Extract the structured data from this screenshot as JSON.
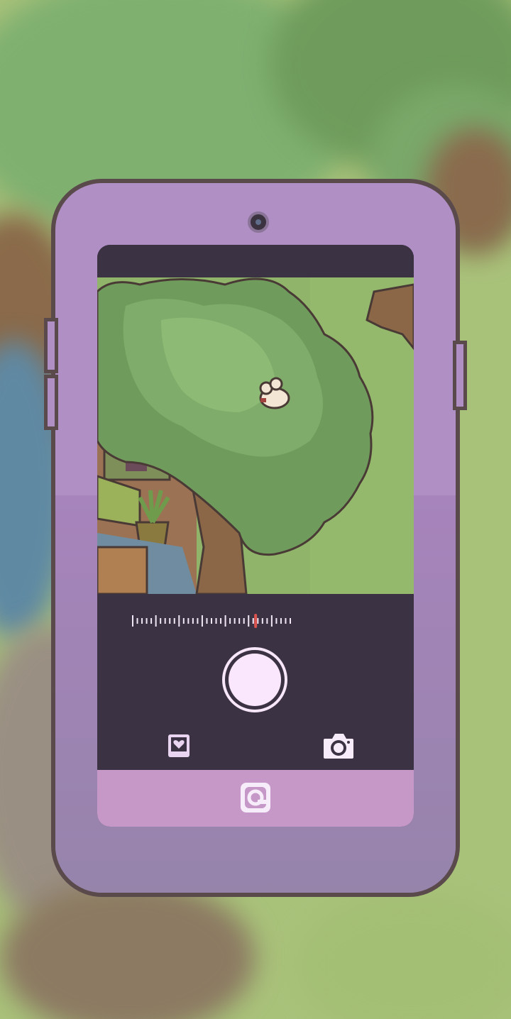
{
  "scene": {
    "description_hidden": false
  },
  "camera_app": {
    "zoom_level": 0.78,
    "icons": {
      "gallery": "heart-photo-icon",
      "switch": "camera-icon",
      "logo": "app-logo-icon",
      "shutter": "shutter-icon"
    }
  },
  "colors": {
    "phone_body": "#b08fc4",
    "phone_outline": "#5a4a4c",
    "screen_dark": "#3b3344",
    "bottom_bar": "#c598c8",
    "shutter_fill": "#fbe7fd",
    "zoom_marker": "#d9534f"
  }
}
